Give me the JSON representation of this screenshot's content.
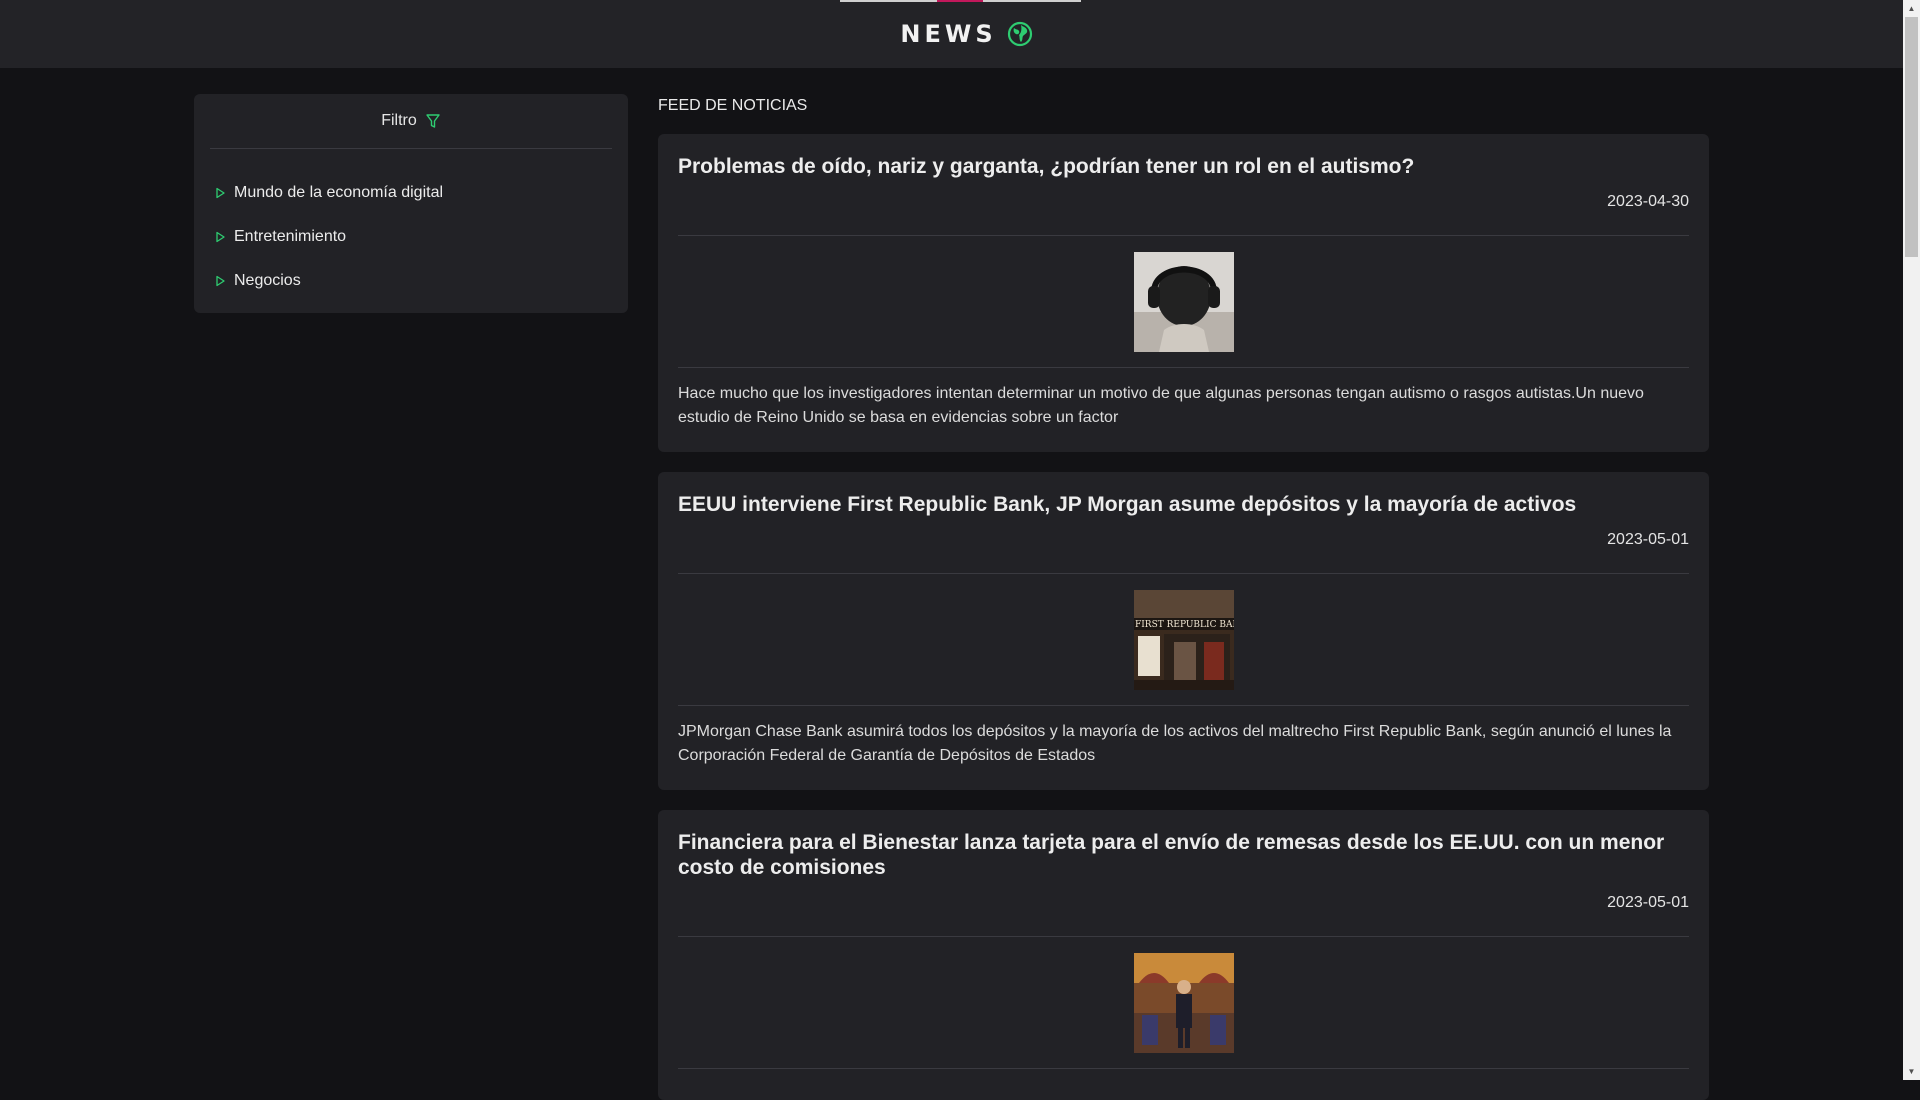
{
  "header": {
    "title": "NEWS",
    "globe_icon": "globe-icon",
    "accent": "#2ecc71"
  },
  "filter": {
    "label": "Filtro",
    "icon": "filter-icon",
    "items": [
      {
        "label": "Mundo de la economía digital"
      },
      {
        "label": "Entretenimiento"
      },
      {
        "label": "Negocios"
      }
    ]
  },
  "feed": {
    "title": "FEED DE NOTICIAS",
    "articles": [
      {
        "title": "Problemas de oído, nariz y garganta, ¿podrían tener un rol en el autismo?",
        "date": "2023-04-30",
        "description": "Hace mucho que los investigadores intentan determinar un motivo de que algunas personas tengan autismo o rasgos autistas.Un nuevo estudio de Reino Unido se basa en evidencias sobre un factor"
      },
      {
        "title": "EEUU interviene First Republic Bank, JP Morgan asume depósitos y la mayoría de activos",
        "date": "2023-05-01",
        "description": "JPMorgan Chase Bank asumirá todos los depósitos y la mayoría de los activos del maltrecho First Republic Bank, según anunció el lunes la Corporación Federal de Garantía de Depósitos de Estados",
        "image_text": "FIRST REPUBLIC BAN"
      },
      {
        "title": "Financiera para el Bienestar lanza tarjeta para el envío de remesas desde los EE.UU. con un menor costo de comisiones",
        "date": "2023-05-01"
      }
    ]
  }
}
